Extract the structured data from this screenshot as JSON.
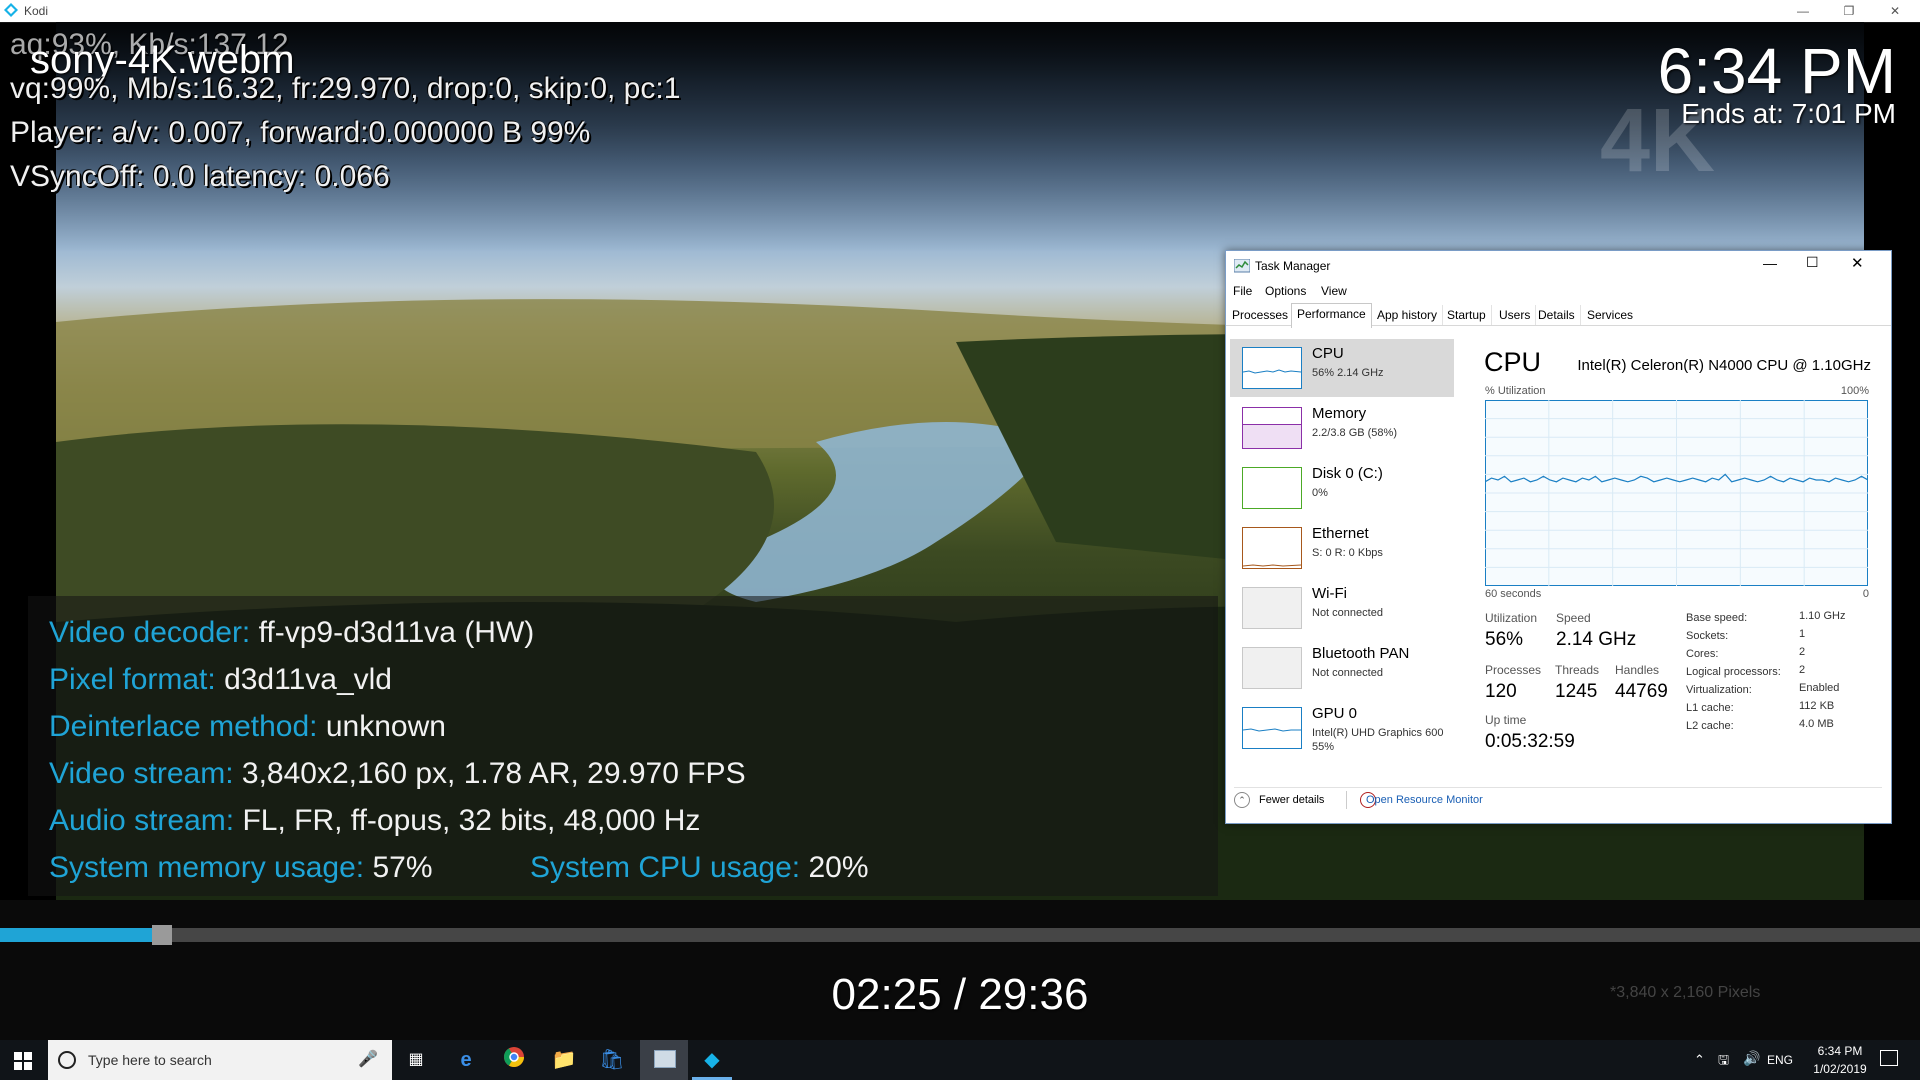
{
  "window": {
    "title": "Kodi"
  },
  "debug": {
    "line1": "aq:93%, Kb/s:137.12",
    "line2": "vq:99%, Mb/s:16.32, fr:29.970, drop:0, skip:0, pc:1",
    "line3": "Player: a/v: 0.007,  forward:0.000000 B 99%",
    "line4": "VSyncOff: 0.0 latency: 0.066"
  },
  "file_title": "sony-4K.webm",
  "clock": {
    "time": "6:34 PM",
    "ends_at": "Ends at: 7:01 PM",
    "badge": "4K"
  },
  "info": {
    "video_decoder": {
      "key": "Video decoder:",
      "value": "ff-vp9-d3d11va (HW)"
    },
    "pixel_format": {
      "key": "Pixel format:",
      "value": "d3d11va_vld"
    },
    "deinterlace": {
      "key": "Deinterlace method:",
      "value": "unknown"
    },
    "video_stream": {
      "key": "Video stream:",
      "value": "3,840x2,160 px, 1.78 AR, 29.970 FPS"
    },
    "audio_stream": {
      "key": "Audio stream:",
      "value": "FL, FR, ff-opus, 32 bits, 48,000 Hz"
    },
    "mem_usage": {
      "key": "System memory usage:",
      "value": "57%"
    },
    "cpu_usage": {
      "key": "System CPU usage:",
      "value": "20%"
    }
  },
  "playback": {
    "time": "02:25 / 29:36",
    "progress_fraction": 0.081,
    "resolution_note": "*3,840 x 2,160 Pixels"
  },
  "task_manager": {
    "title": "Task Manager",
    "menu": [
      "File",
      "Options",
      "View"
    ],
    "tabs": [
      "Processes",
      "Performance",
      "App history",
      "Startup",
      "Users",
      "Details",
      "Services"
    ],
    "active_tab": "Performance",
    "sidebar": [
      {
        "title": "CPU",
        "sub": "56% 2.14 GHz",
        "color": "#1a7fc4"
      },
      {
        "title": "Memory",
        "sub": "2.2/3.8 GB (58%)",
        "color": "#8b2fa8"
      },
      {
        "title": "Disk 0 (C:)",
        "sub": "0%",
        "color": "#4caa26"
      },
      {
        "title": "Ethernet",
        "sub": "S: 0 R: 0 Kbps",
        "color": "#a7581c"
      },
      {
        "title": "Wi-Fi",
        "sub": "Not connected",
        "color": "#c0c0c0"
      },
      {
        "title": "Bluetooth PAN",
        "sub": "Not connected",
        "color": "#c0c0c0"
      },
      {
        "title": "GPU 0",
        "sub": "Intel(R) UHD Graphics 600",
        "sub2": "55%",
        "color": "#1a7fc4"
      }
    ],
    "cpu": {
      "heading": "CPU",
      "model": "Intel(R) Celeron(R) N4000 CPU @ 1.10GHz",
      "util_label": "% Utilization",
      "max_label": "100%",
      "time_label": "60 seconds",
      "min_label": "0",
      "utilization_label": "Utilization",
      "utilization": "56%",
      "speed_label": "Speed",
      "speed": "2.14 GHz",
      "processes_label": "Processes",
      "processes": "120",
      "threads_label": "Threads",
      "threads": "1245",
      "handles_label": "Handles",
      "handles": "44769",
      "uptime_label": "Up time",
      "uptime": "0:05:32:59",
      "specs": [
        {
          "k": "Base speed:",
          "v": "1.10 GHz"
        },
        {
          "k": "Sockets:",
          "v": "1"
        },
        {
          "k": "Cores:",
          "v": "2"
        },
        {
          "k": "Logical processors:",
          "v": "2"
        },
        {
          "k": "Virtualization:",
          "v": "Enabled"
        },
        {
          "k": "L1 cache:",
          "v": "112 KB"
        },
        {
          "k": "L2 cache:",
          "v": "4.0 MB"
        }
      ],
      "graph_util": [
        0.56,
        0.58,
        0.57,
        0.59,
        0.56,
        0.57,
        0.58,
        0.56,
        0.57,
        0.59,
        0.57,
        0.56,
        0.58,
        0.57,
        0.56,
        0.58,
        0.57,
        0.59,
        0.56,
        0.57,
        0.58,
        0.57,
        0.56,
        0.57,
        0.59,
        0.58,
        0.56,
        0.57,
        0.58,
        0.57,
        0.56,
        0.57,
        0.58,
        0.57,
        0.56,
        0.58,
        0.57,
        0.6,
        0.56,
        0.57,
        0.58,
        0.57,
        0.56,
        0.57,
        0.59,
        0.57,
        0.56,
        0.58,
        0.57,
        0.56,
        0.58,
        0.57,
        0.57,
        0.56,
        0.58,
        0.57,
        0.56,
        0.57,
        0.59,
        0.57
      ]
    },
    "footer": {
      "fewer": "Fewer details",
      "monitor": "Open Resource Monitor"
    }
  },
  "taskbar": {
    "search_placeholder": "Type here to search",
    "lang": "ENG",
    "time": "6:34 PM",
    "date": "1/02/2019"
  }
}
